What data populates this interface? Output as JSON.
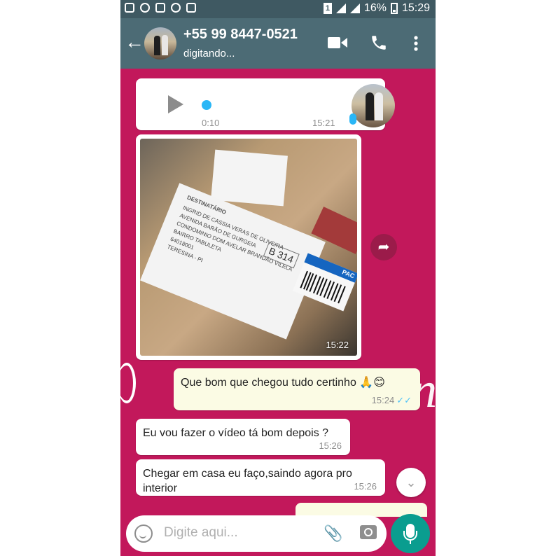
{
  "status_bar": {
    "battery": "16%",
    "time": "15:29",
    "sim": "1"
  },
  "header": {
    "title": "+55 99 8447-0521",
    "subtitle": "digitando..."
  },
  "messages": [
    {
      "type": "audio",
      "direction": "in",
      "duration": "0:10",
      "time": "15:21"
    },
    {
      "type": "image",
      "direction": "in",
      "time": "15:22",
      "label_lines": [
        "DESTINATÁRIO",
        "INGRID DE CASSIA VERAS DE OLIVEIRA",
        "AVENIDA BARÃO DE GURGEIA",
        "CONDOMINIO DOM AVELAR BRANDÃO VILELA",
        "BAIRRO TABULETA",
        "64018001",
        "TERESINA - PI"
      ],
      "code": "B 314",
      "pac": "PAC"
    },
    {
      "type": "text",
      "direction": "out",
      "text": "Que bom que chegou tudo certinho 🙏😊",
      "time": "15:24",
      "ticks": "✓✓"
    },
    {
      "type": "text",
      "direction": "in",
      "text": "Eu vou fazer o vídeo tá bom depois ?",
      "time": "15:26"
    },
    {
      "type": "text",
      "direction": "in",
      "text": "Chegar em casa eu faço,saindo agora pro interior",
      "time": "15:26"
    }
  ],
  "composer": {
    "placeholder": "Digite aqui..."
  },
  "icons": {
    "back": "arrow-left-icon",
    "video": "video-call-icon",
    "call": "phone-icon",
    "menu": "more-vert-icon",
    "share": "forward-icon",
    "scroll": "chevron-double-down-icon",
    "emoji": "emoji-icon",
    "attach": "paperclip-icon",
    "camera": "camera-icon",
    "mic": "microphone-icon"
  },
  "colors": {
    "wallpaper": "#c2185b",
    "header": "#4c6b75",
    "accent": "#0a9d8f",
    "outgoing": "#fbfbe4"
  }
}
